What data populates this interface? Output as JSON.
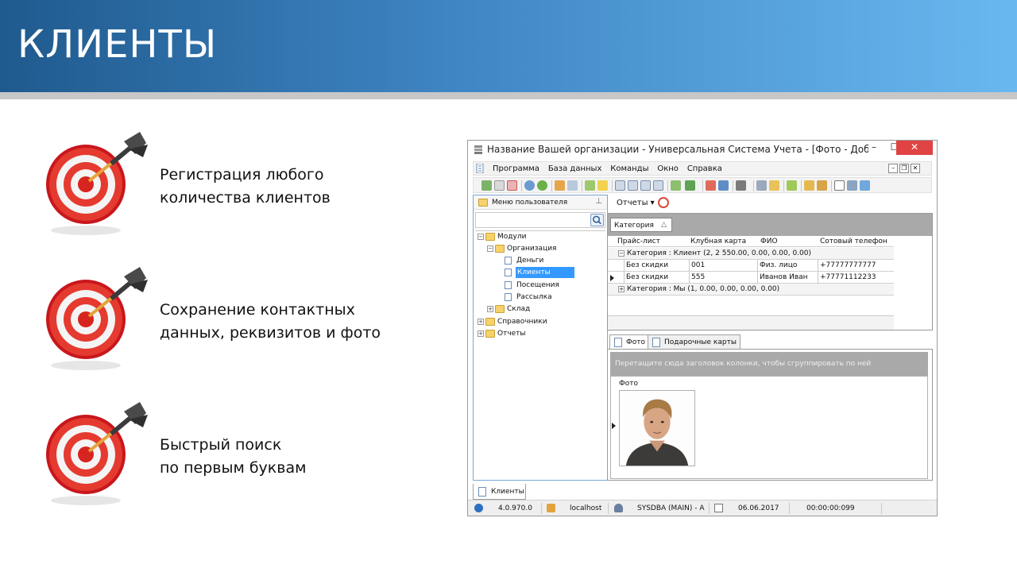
{
  "slide": {
    "title": "КЛИЕНТЫ",
    "bullets": [
      {
        "line1": "Регистрация любого",
        "line2": "количества клиентов"
      },
      {
        "line1": "Сохранение контактных",
        "line2": "данных, реквизитов и фото"
      },
      {
        "line1": "Быстрый поиск",
        "line2": "по первым буквам"
      }
    ]
  },
  "window": {
    "title": "Название Вашей организации - Универсальная Система Учета - [Фото - Добавлен...",
    "controls": {
      "minimize": "–",
      "maximize": "☐",
      "close": "✕"
    },
    "menu": [
      "Программа",
      "База данных",
      "Команды",
      "Окно",
      "Справка"
    ],
    "left_panel": {
      "title": "Меню пользователя",
      "tree": [
        {
          "label": "Модули",
          "level": 0,
          "type": "folder",
          "expander": "−"
        },
        {
          "label": "Организация",
          "level": 1,
          "type": "folder",
          "expander": "−"
        },
        {
          "label": "Деньги",
          "level": 2,
          "type": "doc"
        },
        {
          "label": "Клиенты",
          "level": 2,
          "type": "doc",
          "selected": true
        },
        {
          "label": "Посещения",
          "level": 2,
          "type": "doc"
        },
        {
          "label": "Рассылка",
          "level": 2,
          "type": "doc"
        },
        {
          "label": "Склад",
          "level": 1,
          "type": "folder",
          "expander": "+"
        },
        {
          "label": "Справочники",
          "level": 0,
          "type": "folder",
          "expander": "+"
        },
        {
          "label": "Отчеты",
          "level": 0,
          "type": "folder",
          "expander": "+"
        }
      ]
    },
    "reports_label": "Отчеты ▾",
    "grid": {
      "group_chip": "Категория",
      "sort_glyph": "△",
      "columns": [
        "Прайс-лист",
        "Клубная карта",
        "ФИО",
        "Сотовый телефон"
      ],
      "group1": "Категория : Клиент (2, 2 550.00, 0.00, 0.00, 0.00)",
      "rows": [
        [
          "Без скидки",
          "001",
          "Физ. лицо",
          "+77777777777"
        ],
        [
          "Без скидки",
          "555",
          "Иванов Иван",
          "+77771112233"
        ]
      ],
      "group2": "Категория : Мы (1, 0.00, 0.00, 0.00, 0.00)"
    },
    "detail_tabs": [
      "Фото",
      "Подарочные карты"
    ],
    "detail_hint": "Перетащите сюда заголовок колонки, чтобы сгруппировать по ней",
    "detail_column": "Фото",
    "bottom_tab": "Клиенты",
    "status": {
      "version": "4.0.970.0",
      "host": "localhost",
      "user": "SYSDBA (MAIN) - A",
      "date": "06.06.2017",
      "timer": "00:00:00:099"
    }
  },
  "colors": {
    "header_dark": "#1f5a8e",
    "header_light": "#6ab8f0",
    "selection": "#3399ff",
    "close": "#e04343"
  }
}
